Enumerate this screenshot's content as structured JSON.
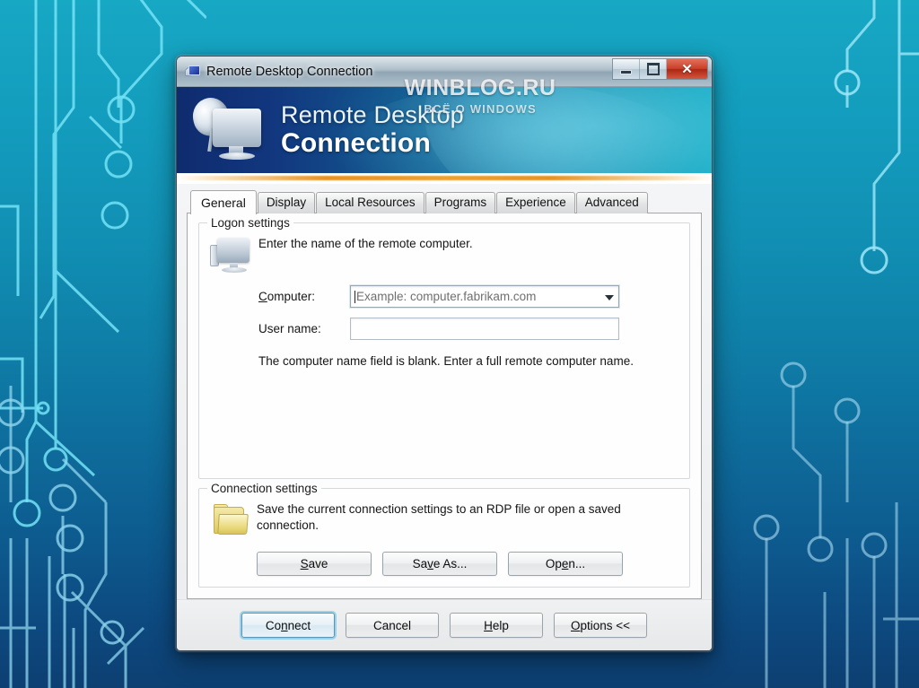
{
  "desktop": {
    "background_top_color": "#17a8c4",
    "background_bottom_color": "#0d3f72",
    "trace_color": "#7fe6f7"
  },
  "watermark": {
    "main": "WINBLOG.RU",
    "sub": "ВСЁ О WINDOWS"
  },
  "window": {
    "title": "Remote Desktop Connection",
    "title_icon": "remote-desktop-icon",
    "controls": {
      "minimize": "–",
      "maximize": "□",
      "close": "✕"
    }
  },
  "banner": {
    "line1": "Remote Desktop",
    "line2": "Connection",
    "icon": "remote-desktop-banner-icon",
    "accent_color": "#e8931f"
  },
  "tabs": [
    {
      "label": "General",
      "active": true
    },
    {
      "label": "Display",
      "active": false
    },
    {
      "label": "Local Resources",
      "active": false
    },
    {
      "label": "Programs",
      "active": false
    },
    {
      "label": "Experience",
      "active": false
    },
    {
      "label": "Advanced",
      "active": false
    }
  ],
  "logon_settings": {
    "title": "Logon settings",
    "icon": "computer-monitor-icon",
    "description": "Enter the name of the remote computer.",
    "computer_label": "Computer:",
    "computer_label_accel": "C",
    "computer_value": "",
    "computer_placeholder": "Example: computer.fabrikam.com",
    "username_label": "User name:",
    "username_value": "",
    "hint": "The computer name field is blank. Enter a full remote computer name."
  },
  "connection_settings": {
    "title": "Connection settings",
    "icon": "folder-icon",
    "description": "Save the current connection settings to an RDP file or open a saved connection.",
    "buttons": [
      {
        "label": "Save",
        "accel": "S"
      },
      {
        "label": "Save As...",
        "accel": "v"
      },
      {
        "label": "Open...",
        "accel": "e"
      }
    ]
  },
  "footer": {
    "buttons": [
      {
        "label": "Connect",
        "accel": "n",
        "default": true
      },
      {
        "label": "Cancel",
        "accel": "",
        "default": false
      },
      {
        "label": "Help",
        "accel": "H",
        "default": false
      },
      {
        "label": "Options <<",
        "accel": "O",
        "default": false
      }
    ]
  }
}
